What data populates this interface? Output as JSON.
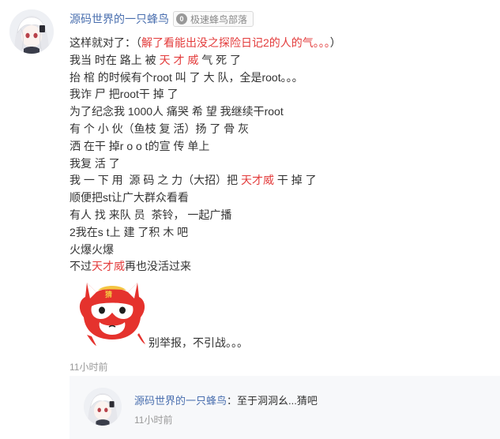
{
  "comment": {
    "username": "源码世界的一只蜂鸟",
    "badge": {
      "icon_text": "0",
      "label": "极速蜂鸟部落"
    },
    "lines": [
      [
        {
          "t": "这样就对了：（"
        },
        {
          "t": "解了看能出没之探险日记2的人的气。。。",
          "red": true
        },
        {
          "t": "）"
        }
      ],
      [
        {
          "t": "我当 时在 路上 被 "
        },
        {
          "t": "天 才 威",
          "red": true
        },
        {
          "t": " 气 死 了"
        }
      ],
      [
        {
          "t": "抬 棺 的时候有个root 叫 了 大 队，全是root。。。"
        }
      ],
      [
        {
          "t": "我诈 尸 把root干 掉 了"
        }
      ],
      [
        {
          "t": "为了纪念我 1000人 痛哭 希 望 我继续干root"
        }
      ],
      [
        {
          "t": "有 个 小 伙（鱼枝 复 活）扬 了 骨 灰"
        }
      ],
      [
        {
          "t": "洒 在干 掉r o o t的宣 传 单上"
        }
      ],
      [
        {
          "t": "我复 活 了"
        }
      ],
      [
        {
          "t": "我 一 下 用  源 码 之 力（大招）把 "
        },
        {
          "t": "天才威",
          "red": true
        },
        {
          "t": " 干 掉 了"
        }
      ],
      [
        {
          "t": "顺便把st让广大群众看看"
        }
      ],
      [
        {
          "t": "有人 找 来队 员  茶铃， 一起广播"
        }
      ],
      [
        {
          "t": "2我在s t上 建 了积 木 吧"
        }
      ],
      [
        {
          "t": "火爆火爆"
        }
      ],
      [
        {
          "t": "不过"
        },
        {
          "t": "天才威",
          "red": true
        },
        {
          "t": "再也没活过来"
        }
      ]
    ],
    "sticker_caption": "别举报，不引战。。。",
    "time": "11小时前"
  },
  "reply": {
    "username": "源码世界的一只蜂鸟",
    "separator": "：",
    "text": "至于洞洞幺...猜吧",
    "time": "11小时前"
  },
  "colors": {
    "link": "#4a6faf",
    "highlight": "#e33b3b",
    "muted": "#999999",
    "reply_bg": "#f7f8fa"
  },
  "icons": {
    "badge": "level-badge-icon",
    "sticker": "red-hooded-cat-sticker"
  }
}
